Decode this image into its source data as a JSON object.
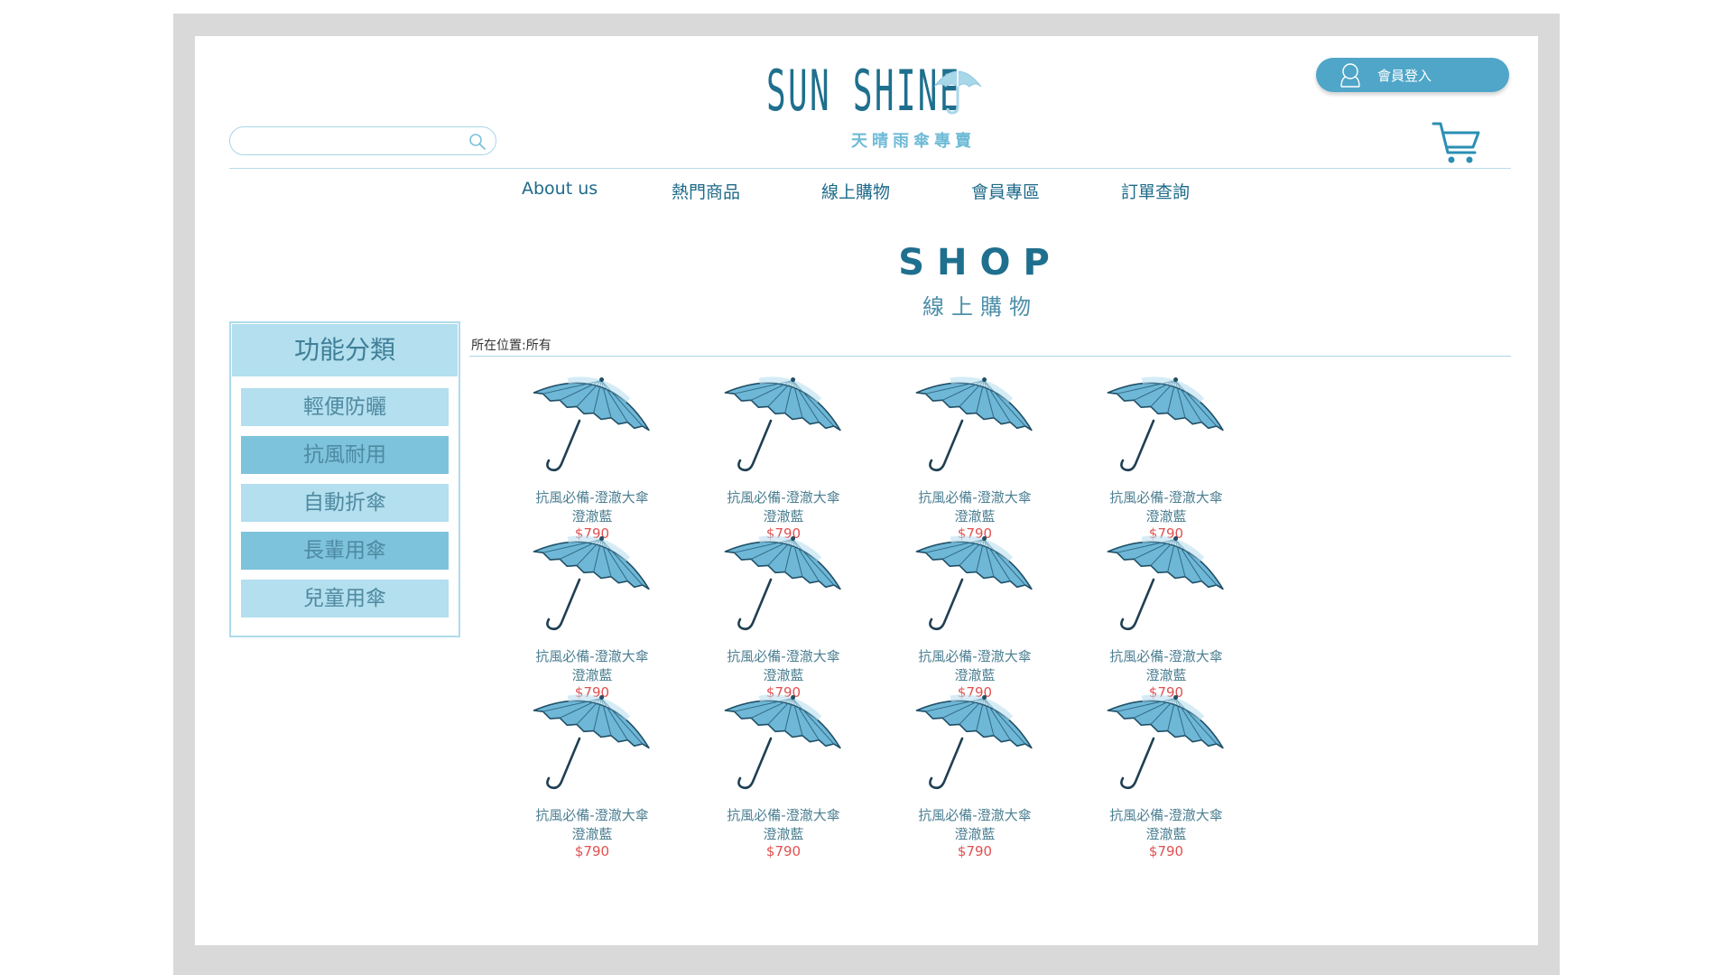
{
  "brand": {
    "name": "SUN SHINE",
    "tagline": "天晴雨傘專賣",
    "primary_color": "#1f6f8e",
    "accent_color": "#4fa6c8"
  },
  "header": {
    "login_label": "會員登入",
    "search": {
      "value": "",
      "placeholder": ""
    },
    "icons": [
      "user-icon",
      "cart-icon",
      "search-icon"
    ]
  },
  "nav": {
    "items": [
      {
        "label": "About us"
      },
      {
        "label": "熱門商品"
      },
      {
        "label": "線上購物"
      },
      {
        "label": "會員專區"
      },
      {
        "label": "訂單查詢"
      }
    ]
  },
  "shop": {
    "title": "SHOP",
    "subtitle": "線上購物",
    "breadcrumb": "所在位置:所有"
  },
  "sidebar": {
    "title": "功能分類",
    "items": [
      {
        "label": "輕便防曬"
      },
      {
        "label": "抗風耐用"
      },
      {
        "label": "自動折傘"
      },
      {
        "label": "長輩用傘"
      },
      {
        "label": "兒童用傘"
      }
    ]
  },
  "products": [
    {
      "name": "抗風必備-澄澈大傘",
      "color": "澄澈藍",
      "price": "$790"
    },
    {
      "name": "抗風必備-澄澈大傘",
      "color": "澄澈藍",
      "price": "$790"
    },
    {
      "name": "抗風必備-澄澈大傘",
      "color": "澄澈藍",
      "price": "$790"
    },
    {
      "name": "抗風必備-澄澈大傘",
      "color": "澄澈藍",
      "price": "$790"
    },
    {
      "name": "抗風必備-澄澈大傘",
      "color": "澄澈藍",
      "price": "$790"
    },
    {
      "name": "抗風必備-澄澈大傘",
      "color": "澄澈藍",
      "price": "$790"
    },
    {
      "name": "抗風必備-澄澈大傘",
      "color": "澄澈藍",
      "price": "$790"
    },
    {
      "name": "抗風必備-澄澈大傘",
      "color": "澄澈藍",
      "price": "$790"
    },
    {
      "name": "抗風必備-澄澈大傘",
      "color": "澄澈藍",
      "price": "$790"
    },
    {
      "name": "抗風必備-澄澈大傘",
      "color": "澄澈藍",
      "price": "$790"
    },
    {
      "name": "抗風必備-澄澈大傘",
      "color": "澄澈藍",
      "price": "$790"
    },
    {
      "name": "抗風必備-澄澈大傘",
      "color": "澄澈藍",
      "price": "$790"
    }
  ]
}
